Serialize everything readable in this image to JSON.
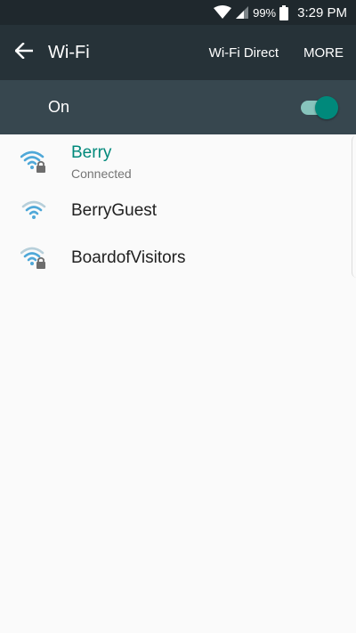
{
  "status_bar": {
    "battery": "99%",
    "time": "3:29 PM"
  },
  "app_bar": {
    "title": "Wi-Fi",
    "back_icon": "arrow-back-icon",
    "actions": [
      "Wi-Fi Direct",
      "MORE"
    ]
  },
  "toggle": {
    "label": "On",
    "state": "on",
    "color": "#00897b"
  },
  "networks": [
    {
      "name": "Berry",
      "status": "Connected",
      "secured": true,
      "connected": true,
      "icon": "wifi-lock-icon"
    },
    {
      "name": "BerryGuest",
      "status": "",
      "secured": false,
      "connected": false,
      "icon": "wifi-icon"
    },
    {
      "name": "BoardofVisitors",
      "status": "",
      "secured": true,
      "connected": false,
      "icon": "wifi-lock-icon"
    }
  ],
  "colors": {
    "status_bar": "#1f282d",
    "app_bar": "#263238",
    "toggle_bar": "#37474f",
    "accent": "#00897b",
    "wifi_icon": "#4fa8d8"
  }
}
